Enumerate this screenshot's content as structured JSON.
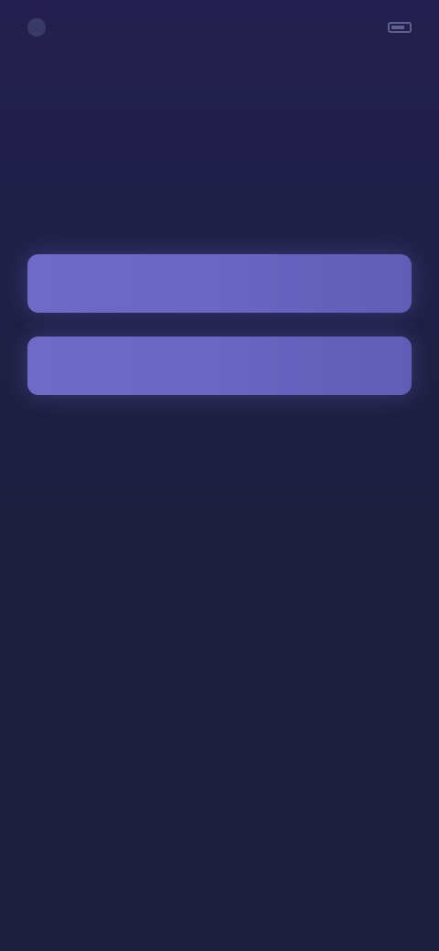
{
  "status_bar": {
    "left_text": "",
    "right_text": ""
  },
  "main": {
    "title": "",
    "subtitle": ""
  },
  "options": [
    {
      "label": ""
    },
    {
      "label": ""
    }
  ],
  "colors": {
    "background": "#1c1f3d",
    "button": "#6965c1",
    "title_text": "#c9c8e6",
    "muted_text": "#6f7199"
  }
}
